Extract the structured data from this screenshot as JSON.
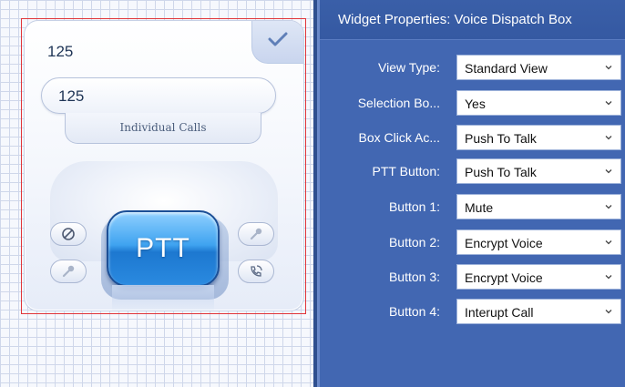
{
  "widget": {
    "title_value": "125",
    "number_field_value": "125",
    "calls_label": "Individual Calls",
    "ptt_label": "PTT",
    "check_icon": "checkmark-icon",
    "side_buttons": [
      {
        "icon": "no-entry-icon"
      },
      {
        "icon": "key-icon"
      },
      {
        "icon": "key-icon"
      },
      {
        "icon": "phone-callback-icon"
      }
    ]
  },
  "panel": {
    "title": "Widget Properties: Voice Dispatch Box",
    "properties": [
      {
        "label": "View Type:",
        "value": "Standard View"
      },
      {
        "label": "Selection Bo...",
        "value": "Yes"
      },
      {
        "label": "Box Click Ac...",
        "value": "Push To Talk"
      },
      {
        "label": "PTT Button:",
        "value": "Push To Talk"
      },
      {
        "label": "Button 1:",
        "value": "Mute"
      },
      {
        "label": "Button 2:",
        "value": "Encrypt Voice"
      },
      {
        "label": "Button 3:",
        "value": "Encrypt Voice"
      },
      {
        "label": "Button 4:",
        "value": "Interupt Call"
      }
    ]
  },
  "colors": {
    "panel_bg": "#4267b2",
    "ptt_blue": "#2a8ae0",
    "selection_border": "#e0353a"
  }
}
